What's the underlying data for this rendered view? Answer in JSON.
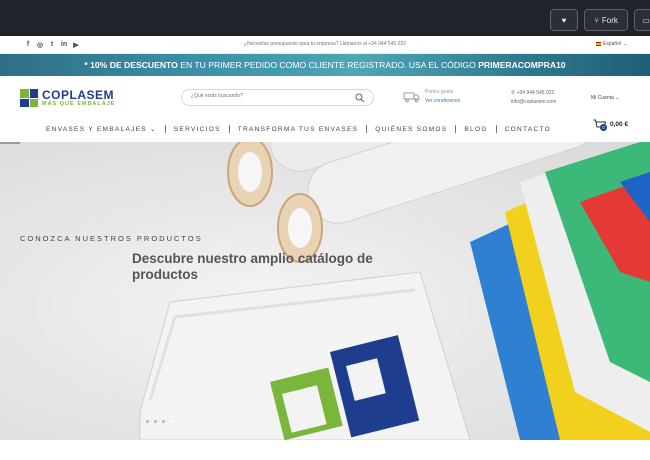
{
  "github_bar": {
    "fork_label": "Fork"
  },
  "info_strip": {
    "text": "¿Necesitas presupuesto para tu empresa? Llámanos al +34 944 545 022",
    "language": "Español"
  },
  "promo": {
    "part1": "* 10% DE DESCUENTO",
    "part2": " EN TU PRIMER PEDIDO COMO CLIENTE REGISTRADO. USA EL CÓDIGO ",
    "code": "PRIMERACOMPRA10"
  },
  "header": {
    "logo_name": "COPLASEM",
    "logo_tagline": "MÁS QUE EMBALAJE",
    "search_placeholder": "¿Qué estás buscando?",
    "shipping_line1": "Portes gratis",
    "shipping_line2": "Ver condiciones",
    "phone": "+34 944 545 022",
    "email": "info@coplasem.com",
    "account_label": "Mi Cuenta",
    "cart_count": "0",
    "cart_total": "0,00 €"
  },
  "nav": {
    "items": [
      "ENVASES Y EMBALAJES",
      "SERVICIOS",
      "TRANSFORMA TUS ENVASES",
      "QUIÉNES SOMOS",
      "BLOG",
      "CONTACTO"
    ]
  },
  "hero": {
    "subtitle": "CONOZCA NUESTROS PRODUCTOS",
    "title": "Descubre nuestro amplio catálogo de productos",
    "active_slide": 4,
    "slide_count": 4
  },
  "colors": {
    "brand_blue": "#1e3d8f",
    "brand_green": "#7ab63b",
    "promo_teal": "#3b8fa8"
  },
  "icons": {
    "social": [
      "facebook-icon",
      "instagram-icon",
      "twitter-icon",
      "linkedin-icon",
      "youtube-icon"
    ],
    "search": "search-icon",
    "truck": "truck-icon",
    "phone": "phone-icon",
    "cart": "cart-icon"
  }
}
